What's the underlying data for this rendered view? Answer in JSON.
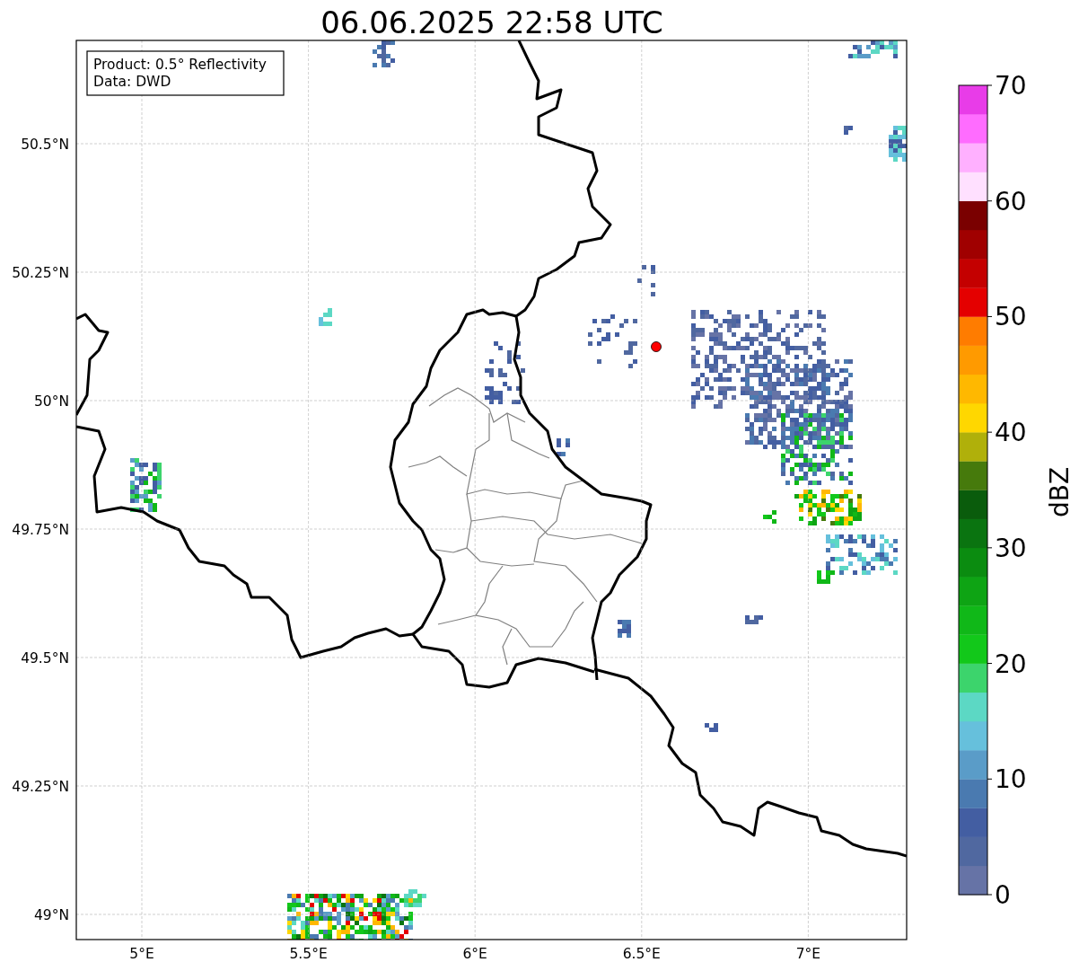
{
  "title": "06.06.2025 22:58 UTC",
  "info_box": {
    "lines": [
      "Product: 0.5° Reflectivity",
      "Data: DWD"
    ]
  },
  "map": {
    "y_ticks": [
      "50.5°N",
      "50.25°N",
      "50°N",
      "49.75°N",
      "49.5°N",
      "49.25°N",
      "49°N"
    ],
    "x_ticks": [
      "5°E",
      "5.5°E",
      "6°E",
      "6.5°E",
      "7°E"
    ]
  },
  "colorbar": {
    "label": "dBZ",
    "ticks": [
      "70",
      "60",
      "50",
      "40",
      "30",
      "20",
      "10",
      "0"
    ],
    "bands": [
      {
        "color": "#6673a6"
      },
      {
        "color": "#5068a0"
      },
      {
        "color": "#435ea2"
      },
      {
        "color": "#4a7ab0"
      },
      {
        "color": "#5a9cc8"
      },
      {
        "color": "#66c0dc"
      },
      {
        "color": "#5cd8c4"
      },
      {
        "color": "#3cd46c"
      },
      {
        "color": "#12c81a"
      },
      {
        "color": "#10b818"
      },
      {
        "color": "#0ea414"
      },
      {
        "color": "#0b8c10"
      },
      {
        "color": "#0a7410"
      },
      {
        "color": "#0a5c0c"
      },
      {
        "color": "#467a0c"
      },
      {
        "color": "#b0b00a"
      },
      {
        "color": "#ffd700"
      },
      {
        "color": "#ffb800"
      },
      {
        "color": "#ff9a00"
      },
      {
        "color": "#ff7c00"
      },
      {
        "color": "#e40000"
      },
      {
        "color": "#c40000"
      },
      {
        "color": "#a00000"
      },
      {
        "color": "#7a0000"
      },
      {
        "color": "#ffe0ff"
      },
      {
        "color": "#ffb0ff"
      },
      {
        "color": "#ff6cff"
      },
      {
        "color": "#e83ce8"
      }
    ]
  }
}
